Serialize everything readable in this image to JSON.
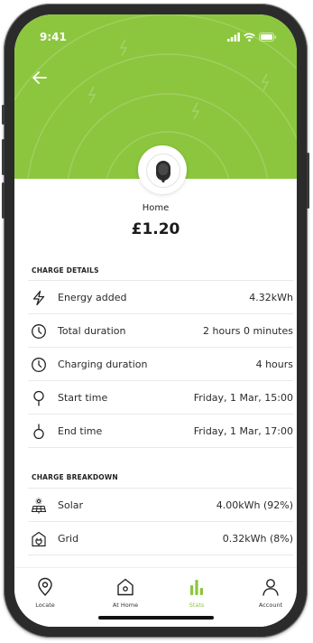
{
  "status_bar": {
    "time": "9:41"
  },
  "session": {
    "site_name": "Home",
    "cost": "£1.20"
  },
  "charge_details": {
    "title": "CHARGE DETAILS",
    "rows": [
      {
        "icon": "lightning-icon",
        "label": "Energy added",
        "value": "4.32kWh"
      },
      {
        "icon": "clock-icon",
        "label": "Total duration",
        "value": "2 hours 0 minutes"
      },
      {
        "icon": "clock-icon",
        "label": "Charging duration",
        "value": "4 hours"
      },
      {
        "icon": "pin-start-icon",
        "label": "Start time",
        "value": "Friday, 1 Mar, 15:00"
      },
      {
        "icon": "pin-end-icon",
        "label": "End time",
        "value": "Friday, 1 Mar, 17:00"
      }
    ]
  },
  "charge_breakdown": {
    "title": "CHARGE BREAKDOWN",
    "rows": [
      {
        "icon": "solar-panel-icon",
        "label": "Solar",
        "value": "4.00kWh (92%)"
      },
      {
        "icon": "grid-plug-icon",
        "label": "Grid",
        "value": "0.32kWh (8%)"
      }
    ]
  },
  "tab_bar": {
    "items": [
      {
        "label": "Locate",
        "icon": "location-pin-icon"
      },
      {
        "label": "At Home",
        "icon": "house-icon"
      },
      {
        "label": "Stats",
        "icon": "bar-chart-icon",
        "active": true
      },
      {
        "label": "Account",
        "icon": "person-icon"
      }
    ]
  },
  "colors": {
    "accent": "#8cc63e",
    "text": "#1f1f1f",
    "divider": "#e9e9e9"
  }
}
